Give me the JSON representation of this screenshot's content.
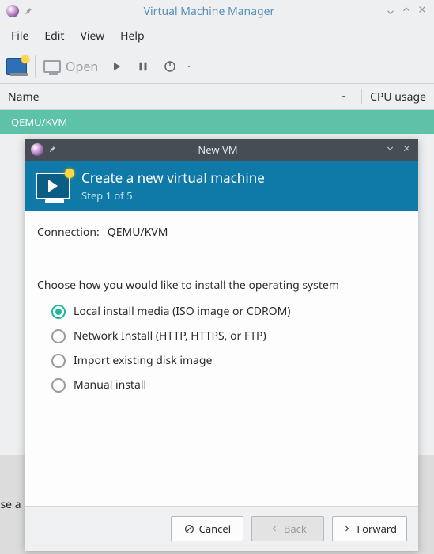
{
  "main_window": {
    "title": "Virtual Machine Manager",
    "menubar": {
      "file": "File",
      "edit": "Edit",
      "view": "View",
      "help": "Help"
    },
    "toolbar": {
      "open_label": "Open"
    },
    "list": {
      "col_name": "Name",
      "col_cpu": "CPU usage",
      "rows": [
        {
          "name": "QEMU/KVM"
        }
      ]
    },
    "bottom_truncated": "ose a"
  },
  "dialog": {
    "title": "New VM",
    "banner": {
      "heading": "Create a new virtual machine",
      "step": "Step 1 of 5"
    },
    "connection_label": "Connection:",
    "connection_value": "QEMU/KVM",
    "choose_label": "Choose how you would like to install the operating system",
    "options": [
      {
        "label": "Local install media (ISO image or CDROM)",
        "selected": true
      },
      {
        "label": "Network Install (HTTP, HTTPS, or FTP)",
        "selected": false
      },
      {
        "label": "Import existing disk image",
        "selected": false
      },
      {
        "label": "Manual install",
        "selected": false
      }
    ],
    "buttons": {
      "cancel": "Cancel",
      "back": "Back",
      "forward": "Forward"
    }
  }
}
